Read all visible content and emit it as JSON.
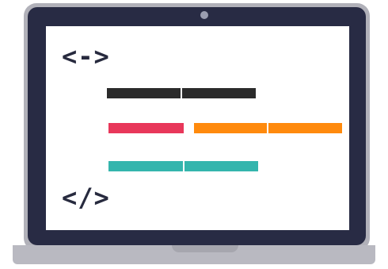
{
  "icons": {
    "open_tag": "<->",
    "close_tag": "</>"
  },
  "colors": {
    "bezel": "#282b44",
    "frame": "#b1b1b9",
    "screen": "#ffffff",
    "line_dark": "#2b2b2b",
    "line_red": "#e8375a",
    "line_orange": "#ff8a0d",
    "line_teal": "#34b5ad"
  }
}
